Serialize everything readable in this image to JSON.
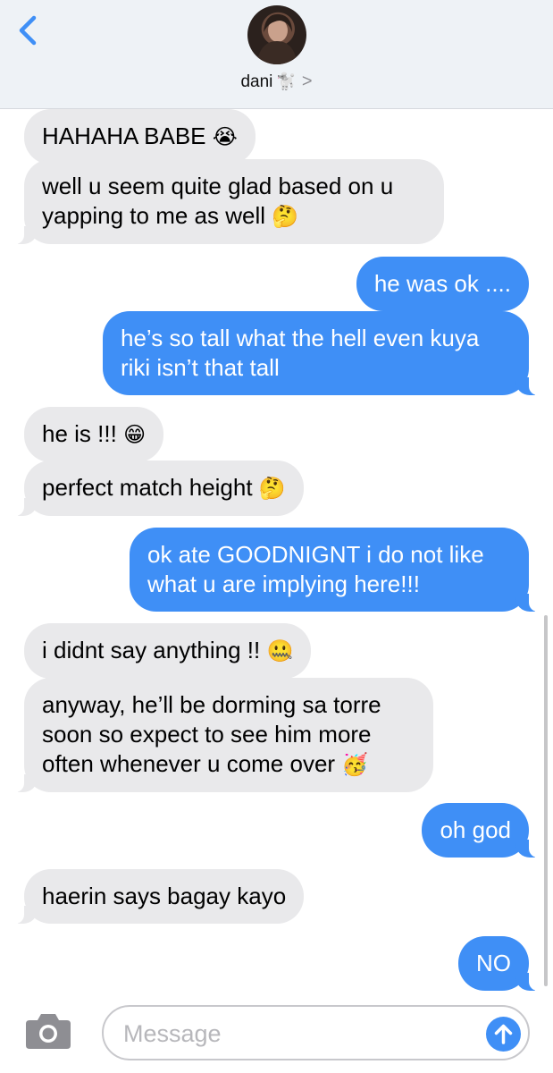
{
  "header": {
    "contact_name": "dani",
    "contact_emoji": "🐩",
    "chevron": ">",
    "back_icon": "chevron-left-icon"
  },
  "messages": [
    {
      "side": "in",
      "text": "HAHAHA BABE",
      "emoji": "😭"
    },
    {
      "side": "in",
      "text": "well u seem quite glad based on u yapping to me as well",
      "emoji": "🤔"
    },
    {
      "side": "out",
      "text": "he was ok ....",
      "emoji": ""
    },
    {
      "side": "out",
      "text": "he’s so tall what the hell even kuya riki isn’t that tall",
      "emoji": ""
    },
    {
      "side": "in",
      "text": "he is !!!",
      "emoji": "😁"
    },
    {
      "side": "in",
      "text": "perfect match height",
      "emoji": "🤔"
    },
    {
      "side": "out",
      "text": "ok ate GOODNIGNT i do not like what u are implying here!!!",
      "emoji": ""
    },
    {
      "side": "in",
      "text": "i didnt say anything !!",
      "emoji": "🤐"
    },
    {
      "side": "in",
      "text": "anyway, he’ll be dorming sa torre soon so expect to see him more often whenever u come over",
      "emoji": "🥳"
    },
    {
      "side": "out",
      "text": "oh god",
      "emoji": ""
    },
    {
      "side": "in",
      "text": "haerin says bagay kayo",
      "emoji": ""
    },
    {
      "side": "out",
      "text": "NO",
      "emoji": ""
    }
  ],
  "composer": {
    "placeholder": "Message",
    "camera_icon": "camera-icon",
    "send_icon": "send-arrow-icon"
  },
  "colors": {
    "incoming_bubble": "#e9e9eb",
    "outgoing_bubble": "#3f8ff6",
    "header_bg": "#eef2f6"
  }
}
